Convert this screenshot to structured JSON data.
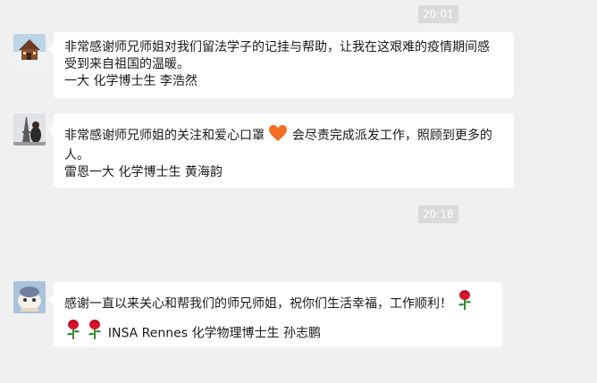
{
  "timestamps": [
    "20:01",
    "20:18"
  ],
  "messages": [
    {
      "lines": [
        "非常感谢师兄师姐对我们留法学子的记挂与帮助，让我在这艰难的疫情期间感",
        "受到来自祖国的温暖。",
        "一大 化学博士生 李浩然"
      ],
      "avatar_icon": "cabin-landscape-avatar"
    },
    {
      "line1_a": "非常感谢师兄师姐的关注和爱心口罩",
      "line1_emoji": "orange-heart-icon",
      "line1_b": "会尽责完成派发工作，照顾到更多的",
      "line2": "人。",
      "line3": "雷恩一大 化学博士生 黄海韵",
      "avatar_icon": "eiffel-tower-photo-avatar"
    },
    {
      "line1": "感谢一直以来关心和帮我们的师兄师姐，祝你们生活幸福，工作顺利！",
      "line2": "INSA Rennes 化学物理博士生 孙志鹏",
      "emoji": "rose-icon",
      "avatar_icon": "cartoon-character-avatar"
    }
  ],
  "colors": {
    "background": "#f0f0f0",
    "bubble": "#ffffff",
    "timestamp_bg": "#dadada",
    "heart": "#f36f25",
    "rose": "#d6152d"
  }
}
